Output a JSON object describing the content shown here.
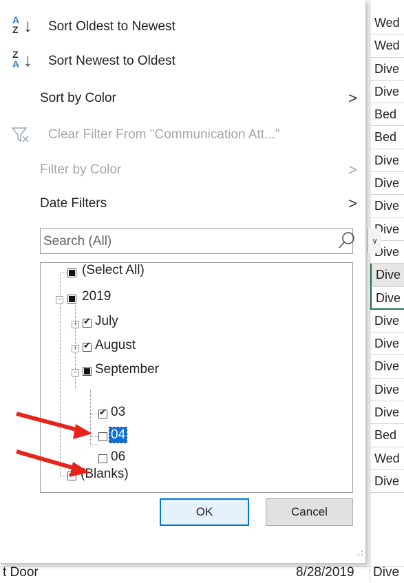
{
  "sheet": {
    "cells": [
      "Wed",
      "Wed",
      "Dive",
      "Dive",
      "Bed",
      "Bed",
      "Dive",
      "Dive",
      "Dive",
      "Dive",
      "Dive",
      "Dive",
      "Dive",
      "Dive",
      "Dive",
      "Dive",
      "Dive",
      "Dive",
      "Bed",
      "Wed",
      "Dive"
    ],
    "bottom_left": "t Door",
    "bottom_date": "8/28/2019",
    "bottom_right": "Dive"
  },
  "menu": {
    "sort_asc": "Sort Oldest to Newest",
    "sort_desc": "Sort Newest to Oldest",
    "sort_by_color": "Sort by Color",
    "clear_filter": "Clear Filter From \"Communication Att...\"",
    "filter_by_color": "Filter by Color",
    "date_filters": "Date Filters"
  },
  "search": {
    "placeholder": "Search (All)"
  },
  "tree": {
    "select_all": "(Select All)",
    "year": "2019",
    "months": [
      "July",
      "August",
      "September"
    ],
    "days": [
      "03",
      "04",
      "06"
    ],
    "blanks": "(Blanks)"
  },
  "buttons": {
    "ok": "OK",
    "cancel": "Cancel"
  },
  "colors": {
    "annotation_arrow": "#e8241a",
    "selection": "#0a6fd8",
    "accent": "#0078d7"
  }
}
